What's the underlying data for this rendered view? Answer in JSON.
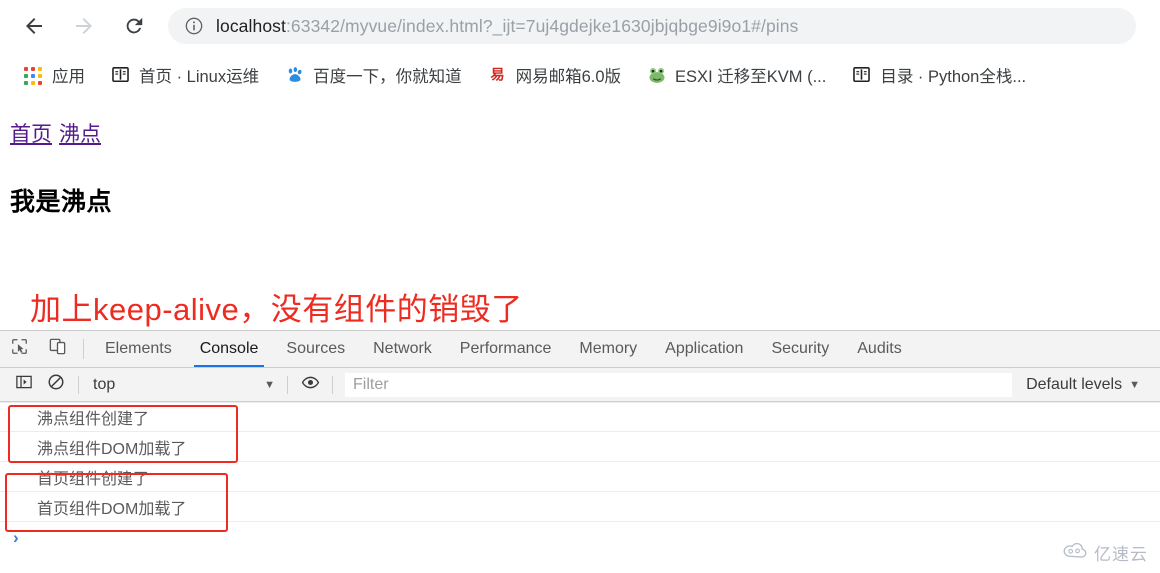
{
  "browser": {
    "back_icon": "arrow-left-icon",
    "forward_icon": "arrow-right-icon",
    "reload_icon": "reload-icon",
    "info_icon": "info-circle-icon",
    "url_host": "localhost",
    "url_rest": ":63342/myvue/index.html?_ijt=7uj4gdejke1630jbjqbge9i9o1#/pins",
    "url_full": "localhost:63342/myvue/index.html?_ijt=7uj4gdejke1630jbjqbge9i9o1#/pins"
  },
  "bookmarks": [
    {
      "label": "应用",
      "icon": "apps-grid-icon"
    },
    {
      "label": "首页 · Linux运维",
      "icon": "book-icon"
    },
    {
      "label": "百度一下，你就知道",
      "icon": "baidu-paw-icon"
    },
    {
      "label": "网易邮箱6.0版",
      "icon": "netease-mail-icon"
    },
    {
      "label": "ESXI 迁移至KVM (...",
      "icon": "frog-icon"
    },
    {
      "label": "目录 · Python全栈...",
      "icon": "book-icon"
    }
  ],
  "page": {
    "links": [
      {
        "label": "首页"
      },
      {
        "label": "沸点"
      }
    ],
    "title": "我是沸点",
    "annotation": "加上keep-alive，没有组件的销毁了",
    "annotation_color": "#ee2b20",
    "link_color": "#551a8b"
  },
  "devtools": {
    "inspect_icon": "inspect-cursor-icon",
    "device_icon": "device-toolbar-icon",
    "tabs": [
      {
        "label": "Elements",
        "active": false
      },
      {
        "label": "Console",
        "active": true
      },
      {
        "label": "Sources",
        "active": false
      },
      {
        "label": "Network",
        "active": false
      },
      {
        "label": "Performance",
        "active": false
      },
      {
        "label": "Memory",
        "active": false
      },
      {
        "label": "Application",
        "active": false
      },
      {
        "label": "Security",
        "active": false
      },
      {
        "label": "Audits",
        "active": false
      }
    ],
    "active_tab_underline_color": "#1a73e8",
    "toolbar": {
      "sidebar_icon": "console-sidebar-icon",
      "clear_icon": "clear-console-icon",
      "context": "top",
      "context_caret": "▼",
      "eye_icon": "live-expression-eye-icon",
      "filter_placeholder": "Filter",
      "filter_value": "",
      "levels_label": "Default levels",
      "levels_caret": "▼"
    },
    "console_messages": [
      {
        "text": "沸点组件创建了"
      },
      {
        "text": "沸点组件DOM加载了"
      },
      {
        "text": "首页组件创建了"
      },
      {
        "text": "首页组件DOM加载了"
      }
    ],
    "prompt_caret": "›"
  },
  "watermark": {
    "text": "亿速云",
    "icon": "cloud-icon"
  }
}
